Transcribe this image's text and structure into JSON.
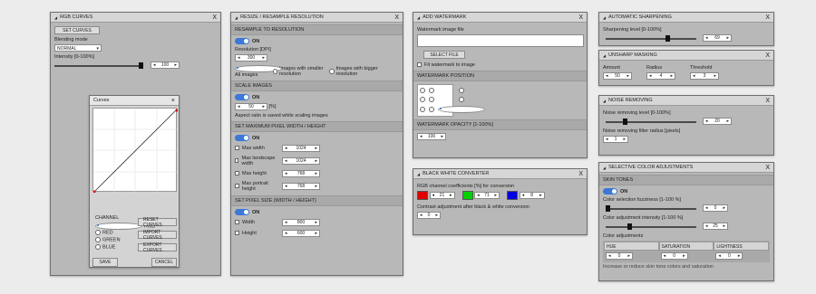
{
  "rgb": {
    "title": "RGB CURVES",
    "set_curves": "SET CURVES",
    "blending_label": "Blending mode",
    "blending_value": "NORMAL",
    "intensity_label": "Intensity [0-100%]",
    "intensity": "100",
    "intensity_pct": 1.0,
    "curves": {
      "title": "Curves",
      "channel_label": "CHANNEL",
      "channels": [
        "RGB",
        "RED",
        "GREEN",
        "BLUE"
      ],
      "reset": "RESET CURVES",
      "import": "IMPORT CURVES",
      "export": "EXPORT CURVES",
      "save": "SAVE",
      "cancel": "CANCEL"
    }
  },
  "resize": {
    "title": "RESIZE / RESAMPLE RESOLUTION",
    "sec_resample": "RESAMPLE TO RESOLUTION",
    "on": "ON",
    "resolution_label": "Resolution [DPI]",
    "resolution": "300",
    "radios": [
      "All images",
      "Images with smaller resolution",
      "Images with bigger resolution"
    ],
    "sec_scale": "SCALE IMAGES",
    "scale_value": "50",
    "scale_unit": "[%]",
    "scale_note": "Aspect ratio is saved while scaling images",
    "sec_max": "SET MAXIMUM PIXEL WIDTH / HEIGHT",
    "max_rows": [
      {
        "label": "Max width",
        "value": "1024"
      },
      {
        "label": "Max landscape width",
        "value": "1024"
      },
      {
        "label": "Max height",
        "value": "768"
      },
      {
        "label": "Max portrait height",
        "value": "768"
      }
    ],
    "sec_size": "SET PIXEL SIZE (WIDTH / HEIGHT)",
    "size_rows": [
      {
        "label": "Width",
        "value": "800"
      },
      {
        "label": "Height",
        "value": "600"
      }
    ]
  },
  "watermark": {
    "title": "ADD WATERMARK",
    "file_label": "Watermark image file",
    "select_file": "SELECT FILE",
    "fit_label": "Fit watermark to image",
    "sec_pos": "WATERMARK POSITION",
    "sec_opacity": "WATERMARK OPACITY [1-100%]",
    "opacity": "100"
  },
  "bw": {
    "title": "BLACK WHITE CONVERTER",
    "coef_label": "RGB channel coefficients [%] for conversion",
    "r": "21",
    "g": "71",
    "b": "8",
    "contrast_label": "Contrast adjustment after black & white conversion",
    "contrast": "0",
    "colors": {
      "r": "#e00000",
      "g": "#00d000",
      "b": "#0000e0"
    }
  },
  "sharpen": {
    "title": "AUTOMATIC SHARPENING",
    "level_label": "Sharpening level [0-100%]",
    "level": "69",
    "level_pct": 0.69
  },
  "unsharp": {
    "title": "UNSHARP MASKING",
    "amount_label": "Amount",
    "radius_label": "Radius",
    "threshold_label": "Threshold",
    "amount": "50",
    "radius": "4",
    "threshold": "3"
  },
  "noise": {
    "title": "NOISE REMOVING",
    "level_label": "Noise removing level [0-100%]",
    "level": "20",
    "level_pct": 0.2,
    "radius_label": "Noise removing filter radius [pixels]",
    "radius": "1"
  },
  "selcolor": {
    "title": "SELECTIVE COLOR ADJUSTMENTS",
    "sec_skin": "SKIN TONES",
    "on": "ON",
    "fuzz_label": "Color selection fuzziness [1-100 %]",
    "fuzz": "0",
    "fuzz_pct": 0.0,
    "intensity_label": "Color adjustment intensity [1-100 %]",
    "intensity": "25",
    "intensity_pct": 0.25,
    "adj_label": "Color adjustments",
    "cols": [
      "HUE",
      "SATURATION",
      "LIGHTNESS"
    ],
    "vals": [
      "0",
      "0",
      "0"
    ],
    "note": "Increase or reduce skin tone colors and saturation"
  }
}
